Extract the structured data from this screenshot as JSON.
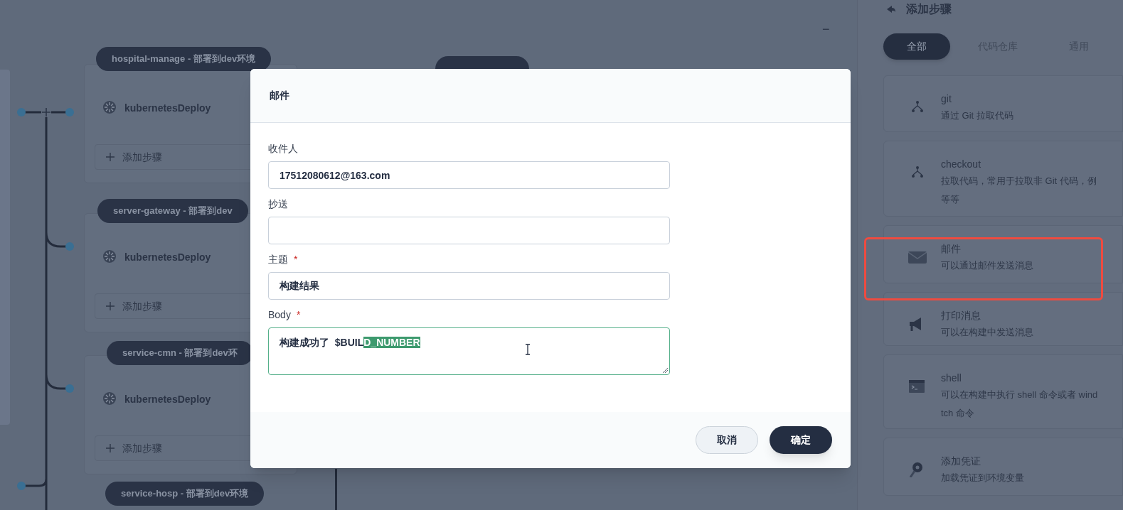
{
  "canvas": {
    "zoom_out": "−",
    "stages": [
      {
        "title": "hospital-manage - 部署到dev环境",
        "steps": [
          "kubernetesDeploy"
        ],
        "add_step": "添加步骤"
      },
      {
        "title": "server-gateway - 部署到dev",
        "steps": [
          "kubernetesDeploy"
        ],
        "add_step": "添加步骤"
      },
      {
        "title": "service-cmn - 部署到dev环",
        "steps": [
          "kubernetesDeploy"
        ],
        "add_step": "添加步骤"
      },
      {
        "title": "service-hosp - 部署到dev环境"
      }
    ]
  },
  "dialog": {
    "title": "邮件",
    "fields": [
      {
        "label": "收件人",
        "kind": "input",
        "value": "17512080612@163.com"
      },
      {
        "label": "抄送",
        "kind": "input"
      },
      {
        "label": "主题",
        "required_mark": "*",
        "kind": "input",
        "value": "构建结果"
      },
      {
        "label": "Body",
        "required_mark": "*",
        "kind": "textarea",
        "value_parts": [
          {
            "text": "构建成功了  $BUIL",
            "selected": false
          },
          {
            "text": "D_NUMBER",
            "selected": true
          }
        ]
      }
    ],
    "buttons": [
      {
        "label": "取消",
        "kind": "secondary"
      },
      {
        "label": "确定",
        "kind": "primary"
      }
    ]
  },
  "panel": {
    "title": "添加步骤",
    "tabs": [
      {
        "label": "全部",
        "selected": true
      },
      {
        "label": "代码仓库",
        "selected": false
      },
      {
        "label": "通用",
        "selected": false
      }
    ],
    "steps": [
      {
        "kind": "git",
        "title": "git",
        "description": [
          "通过 Git 拉取代码"
        ],
        "highlighted": false
      },
      {
        "kind": "checkout",
        "title": "checkout",
        "description": [
          "拉取代码，常用于拉取非 Git 代码，例",
          "等等"
        ],
        "highlighted": false
      },
      {
        "kind": "mail",
        "title": "邮件",
        "description": [
          "可以通过邮件发送消息"
        ],
        "highlighted": true
      },
      {
        "kind": "echo",
        "title": "打印消息",
        "description": [
          "可以在构建中发送消息"
        ],
        "highlighted": false
      },
      {
        "kind": "shell",
        "title": "shell",
        "description": [
          "可以在构建中执行 shell 命令或者 wind",
          "tch 命令"
        ],
        "highlighted": false
      },
      {
        "kind": "credential",
        "title": "添加凭证",
        "description": [
          "加载凭证到环境变量"
        ],
        "highlighted": false
      }
    ]
  }
}
